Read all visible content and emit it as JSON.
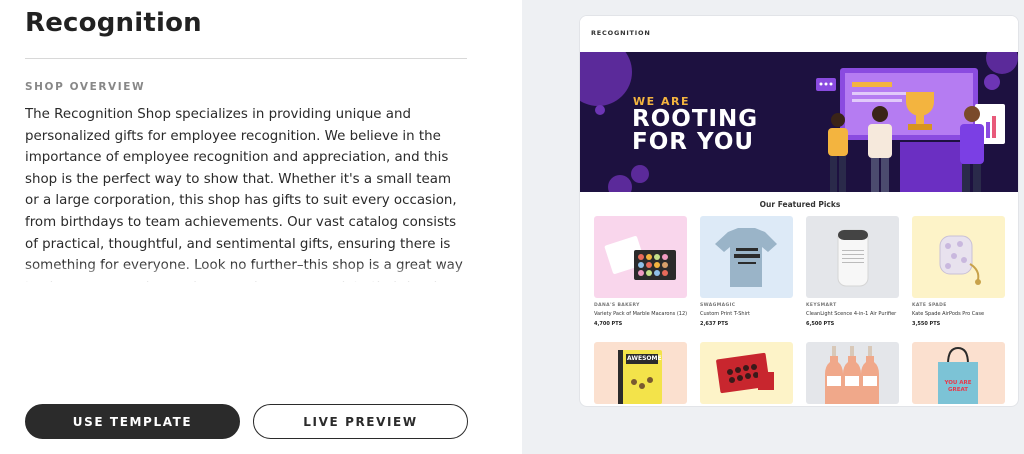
{
  "page": {
    "title": "Recognition",
    "section_label": "SHOP OVERVIEW",
    "description": "The Recognition Shop specializes in providing unique and personalized gifts for employee recognition. We believe in the importance of employee recognition and appreciation, and this shop is the perfect way to show that. Whether it's a small team or a large corporation, this shop has gifts to suit every occasion, from birthdays to team achievements. Our vast catalog consists of practical, thoughtful, and sentimental gifts, ensuring there is something for everyone. Look no further–this shop is a great way to show your employees how much you appreciate their hard work."
  },
  "buttons": {
    "use_template": "USE TEMPLATE",
    "live_preview": "LIVE PREVIEW"
  },
  "preview": {
    "brand": "RECOGNITION",
    "banner": {
      "line1": "WE ARE",
      "line2": "ROOTING",
      "line3": "FOR YOU"
    },
    "featured_title": "Our Featured Picks",
    "products": [
      {
        "brand": "DANA'S BAKERY",
        "name": "Variety Pack of Marble Macarons (12)",
        "points": "4,700 PTS",
        "bg": "#f9d6ec"
      },
      {
        "brand": "SWAGMAGIC",
        "name": "Custom Print T-Shirt",
        "points": "2,637 PTS",
        "bg": "#ddeaf7"
      },
      {
        "brand": "KEYSMART",
        "name": "CleanLight Scence 4-in-1 Air Purifier",
        "points": "6,500 PTS",
        "bg": "#e4e6ea"
      },
      {
        "brand": "KATE SPADE",
        "name": "Kate Spade AirPods Pro Case",
        "points": "3,550 PTS",
        "bg": "#fdf3c8"
      }
    ],
    "products_row2": [
      {
        "bg": "#fbe0cf",
        "label": "AWESOME"
      },
      {
        "bg": "#fdf3c8"
      },
      {
        "bg": "#e4e6ea"
      },
      {
        "bg": "#fbe0cf",
        "label": "YOU ARE GREAT"
      }
    ]
  },
  "colors": {
    "primary_button": "#2b2b2b",
    "right_background": "#eef0f3",
    "banner_background": "#1d1140",
    "banner_accent": "#f3b43f"
  }
}
